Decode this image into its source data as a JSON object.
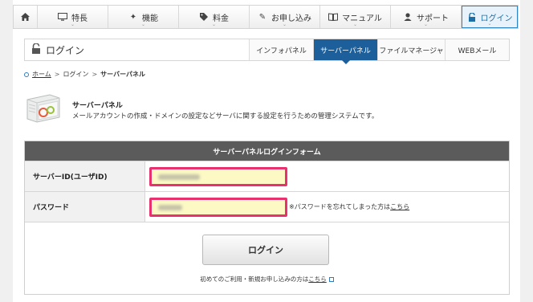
{
  "nav": {
    "items": [
      {
        "label": "",
        "icon": "home-icon"
      },
      {
        "label": "特長",
        "icon": "monitor-icon"
      },
      {
        "label": "機能",
        "icon": "sparkle-icon"
      },
      {
        "label": "料金",
        "icon": "tag-icon"
      },
      {
        "label": "お申し込み",
        "icon": "pencil-icon"
      },
      {
        "label": "マニュアル",
        "icon": "book-icon"
      },
      {
        "label": "サポート",
        "icon": "person-icon"
      },
      {
        "label": "ログイン",
        "icon": "lock-icon",
        "active": true
      }
    ]
  },
  "titlebar": {
    "title": "ログイン",
    "tabs": [
      "インフォパネル",
      "サーバーパネル",
      "ファイルマネージャ",
      "WEBメール"
    ],
    "active_tab": "サーバーパネル"
  },
  "breadcrumb": {
    "home": "ホーム",
    "login": "ログイン",
    "current": "サーバーパネル",
    "separator": ">"
  },
  "intro": {
    "title": "サーバーパネル",
    "description": "メールアカウントの作成・ドメインの設定などサーバに関する設定を行うための管理システムです。"
  },
  "form": {
    "header": "サーバーパネルログインフォーム",
    "id_label": "サーバーID(ユーザID)",
    "password_label": "パスワード",
    "forgot_text": "※パスワードを忘れてしまった方は",
    "forgot_link": "こちら",
    "submit_label": "ログイン",
    "signup_text": "初めてのご利用・新規お申し込みの方は",
    "signup_link": "こちら"
  },
  "colors": {
    "accent": "#1d5f9a",
    "highlight_border": "#e8316f",
    "input_bg": "#fcf9c4",
    "form_header": "#5b5b5b"
  }
}
